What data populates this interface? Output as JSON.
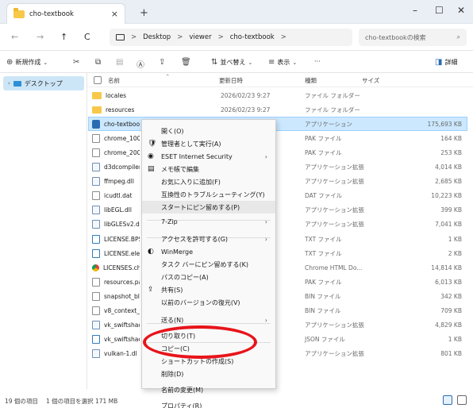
{
  "tab": {
    "title": "cho-textbook",
    "close": "×",
    "new": "+"
  },
  "window": {
    "minimize": "–",
    "maximize": "☐",
    "close": "✕"
  },
  "nav": {
    "back": "←",
    "forward": "→",
    "up": "↑",
    "refresh": "C"
  },
  "breadcrumb": {
    "sep": ">",
    "items": [
      "Desktop",
      "viewer",
      "cho-textbook"
    ]
  },
  "search": {
    "placeholder": "cho-textbookの検索",
    "icon": "⌕"
  },
  "commandbar": {
    "new": "新規作成",
    "sort": "並べ替え",
    "view": "表示",
    "more": "···",
    "details": "詳細"
  },
  "navpane": {
    "desktop": "デスクトップ"
  },
  "columns": {
    "name": "名前",
    "date": "更新日時",
    "type": "種類",
    "size": "サイズ"
  },
  "files": [
    {
      "name": "locales",
      "date": "2026/02/23 9:27",
      "type": "ファイル フォルダー",
      "size": "",
      "icon": "folder"
    },
    {
      "name": "resources",
      "date": "2026/02/23 9:27",
      "type": "ファイル フォルダー",
      "size": "",
      "icon": "folder"
    },
    {
      "name": "cho-textbook",
      "date": "",
      "type": "アプリケーション",
      "size": "175,693 KB",
      "icon": "app"
    },
    {
      "name": "chrome_100",
      "date": "",
      "type": "PAK ファイル",
      "size": "164 KB",
      "icon": "file"
    },
    {
      "name": "chrome_200",
      "date": "",
      "type": "PAK ファイル",
      "size": "253 KB",
      "icon": "file"
    },
    {
      "name": "d3dcompiler",
      "date": "",
      "type": "アプリケーション拡張",
      "size": "4,014 KB",
      "icon": "dll"
    },
    {
      "name": "ffmpeg.dll",
      "date": "",
      "type": "アプリケーション拡張",
      "size": "2,685 KB",
      "icon": "dll"
    },
    {
      "name": "icudtl.dat",
      "date": "",
      "type": "DAT ファイル",
      "size": "10,223 KB",
      "icon": "file"
    },
    {
      "name": "libEGL.dll",
      "date": "",
      "type": "アプリケーション拡張",
      "size": "399 KB",
      "icon": "dll"
    },
    {
      "name": "libGLESv2.dl",
      "date": "",
      "type": "アプリケーション拡張",
      "size": "7,041 KB",
      "icon": "dll"
    },
    {
      "name": "LICENSE.BPS",
      "date": "",
      "type": "TXT ファイル",
      "size": "1 KB",
      "icon": "lic"
    },
    {
      "name": "LICENSE.ele",
      "date": "",
      "type": "TXT ファイル",
      "size": "2 KB",
      "icon": "lic"
    },
    {
      "name": "LICENSES.ch",
      "date": "",
      "type": "Chrome HTML Do...",
      "size": "14,814 KB",
      "icon": "chrome"
    },
    {
      "name": "resources.pa",
      "date": "",
      "type": "PAK ファイル",
      "size": "6,013 KB",
      "icon": "file"
    },
    {
      "name": "snapshot_bl",
      "date": "",
      "type": "BIN ファイル",
      "size": "342 KB",
      "icon": "file"
    },
    {
      "name": "v8_context_",
      "date": "",
      "type": "BIN ファイル",
      "size": "709 KB",
      "icon": "file"
    },
    {
      "name": "vk_swiftshac",
      "date": "",
      "type": "アプリケーション拡張",
      "size": "4,829 KB",
      "icon": "dll"
    },
    {
      "name": "vk_swiftshac",
      "date": "",
      "type": "JSON ファイル",
      "size": "1 KB",
      "icon": "lic"
    },
    {
      "name": "vulkan-1.dl",
      "date": "",
      "type": "アプリケーション拡張",
      "size": "801 KB",
      "icon": "dll"
    }
  ],
  "contextmenu": [
    "開く(O)",
    "管理者として実行(A)",
    "ESET Internet Security",
    "メモ帳で編集",
    "お気に入りに追加(F)",
    "互換性のトラブルシューティング(Y)",
    "スタートにピン留めする(P)",
    "7-Zip",
    "アクセスを許可する(G)",
    "WinMerge",
    "タスク バーにピン留めする(K)",
    "パスのコピー(A)",
    "共有(S)",
    "以前のバージョンの復元(V)",
    "送る(N)",
    "切り取り(T)",
    "コピー(C)",
    "ショートカットの作成(S)",
    "削除(D)",
    "名前の変更(M)",
    "プロパティ(R)"
  ],
  "status": {
    "count": "19 個の項目",
    "selected": "1 個の項目を選択 171 MB"
  }
}
